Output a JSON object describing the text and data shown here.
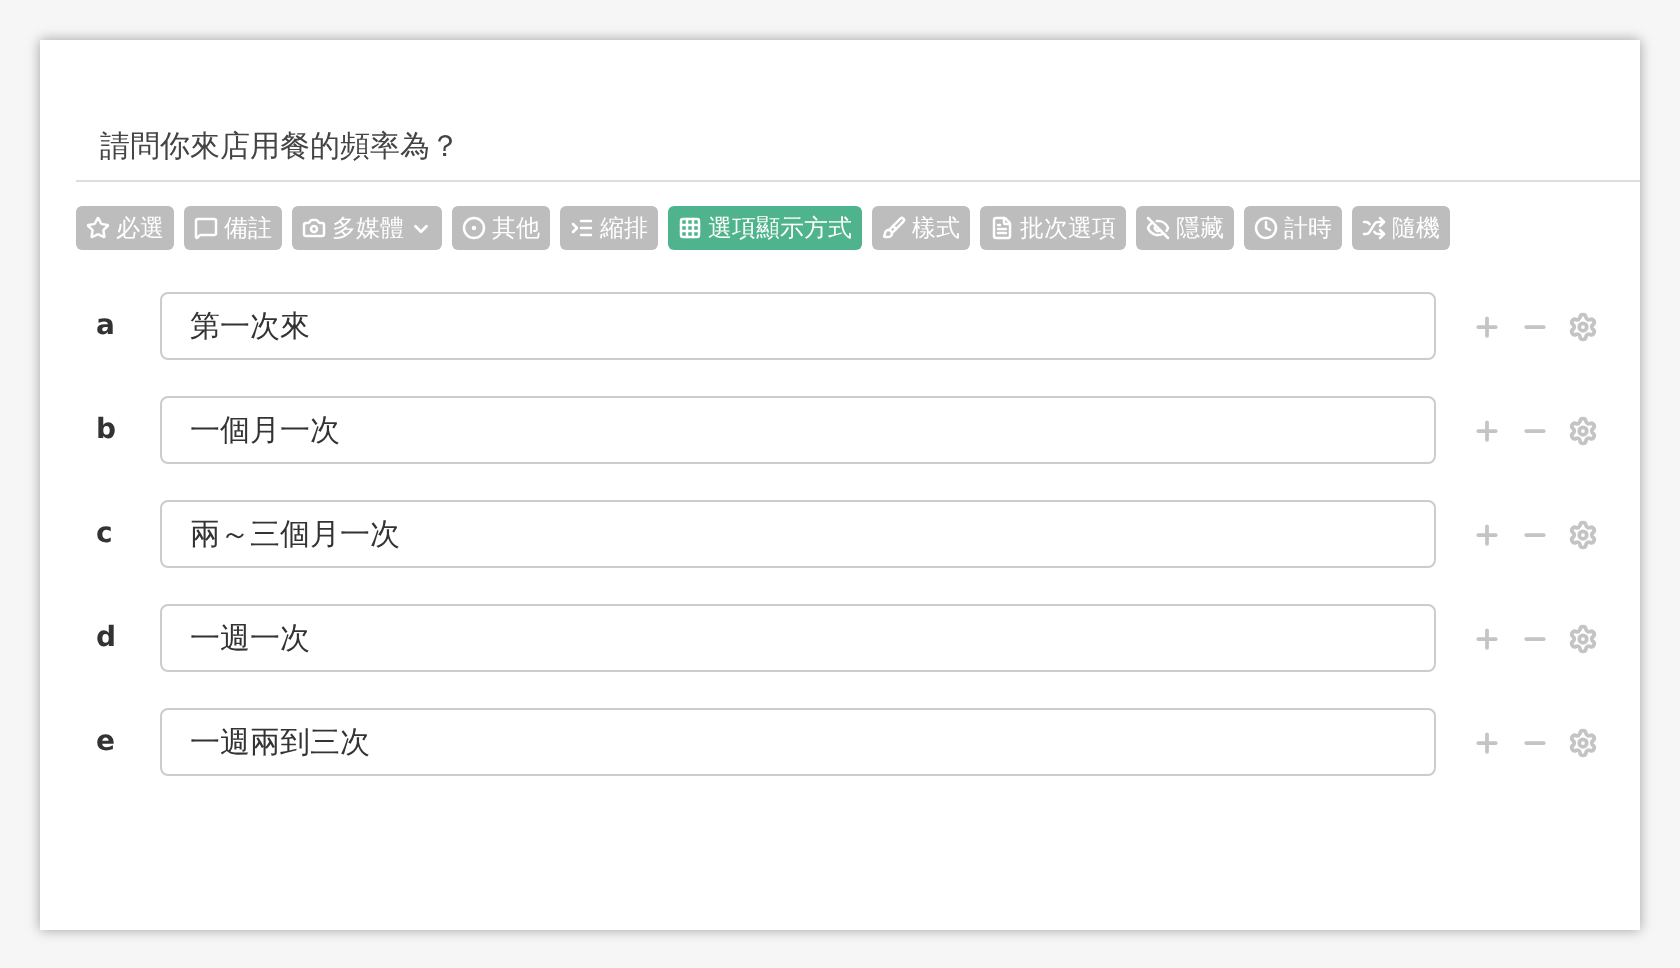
{
  "question": {
    "title": "請問你來店用餐的頻率為？"
  },
  "toolbar": [
    {
      "label": "必選",
      "selected": false
    },
    {
      "label": "備註",
      "selected": false
    },
    {
      "label": "多媒體",
      "selected": false,
      "kind": "dropdown"
    },
    {
      "label": "其他",
      "selected": false
    },
    {
      "label": "縮排",
      "selected": false
    },
    {
      "label": "選項顯示方式",
      "selected": true
    },
    {
      "label": "樣式",
      "selected": false
    },
    {
      "label": "批次選項",
      "selected": false
    },
    {
      "label": "隱藏",
      "selected": false
    },
    {
      "label": "計時",
      "selected": false
    },
    {
      "label": "隨機",
      "selected": false
    }
  ],
  "options": [
    {
      "letter": "a",
      "value": "第一次來"
    },
    {
      "letter": "b",
      "value": "一個月一次"
    },
    {
      "letter": "c",
      "value": "兩～三個月一次"
    },
    {
      "letter": "d",
      "value": "一週一次"
    },
    {
      "letter": "e",
      "value": "一週兩到三次"
    }
  ]
}
